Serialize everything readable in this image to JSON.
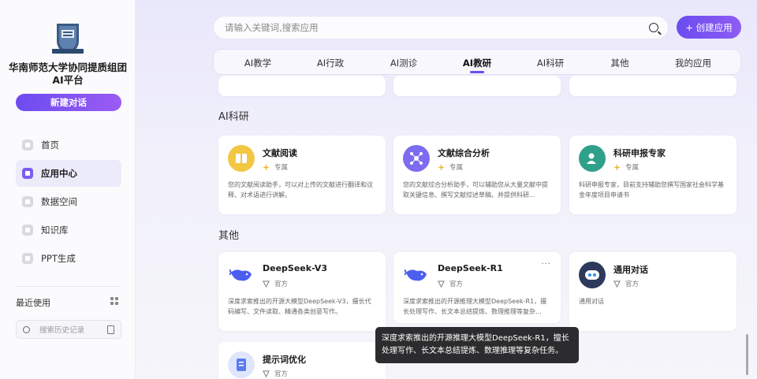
{
  "sidebar": {
    "org_name": "华南师范大学协同提质组团AI平台",
    "new_chat": "新建对话",
    "nav": [
      {
        "label": "首页",
        "icon": "home-icon"
      },
      {
        "label": "应用中心",
        "icon": "apps-icon",
        "active": true
      },
      {
        "label": "数据空间",
        "icon": "data-icon"
      },
      {
        "label": "知识库",
        "icon": "knowledge-icon"
      },
      {
        "label": "PPT生成",
        "icon": "ppt-icon"
      }
    ],
    "recent_label": "最近使用",
    "history_placeholder": "搜索历史记录"
  },
  "header": {
    "search_placeholder": "请输入关键词,搜索应用",
    "create_button": "+ 创建应用",
    "tabs": [
      "AI教学",
      "AI行政",
      "AI测诊",
      "AI教研",
      "AI科研",
      "其他",
      "我的应用"
    ],
    "active_tab": "AI教研"
  },
  "sections": {
    "research": {
      "title": "AI科研",
      "cards": [
        {
          "name": "文献阅读",
          "tag": "专属",
          "desc": "您的文献阅读助手，可以对上传的文献进行翻译和诠释、对术语进行讲解。"
        },
        {
          "name": "文献综合分析",
          "tag": "专属",
          "desc": "您的文献综合分析助手，可以辅助您从大量文献中提取关键信息、撰写文献综述草稿、并提供科研..."
        },
        {
          "name": "科研申报专家",
          "tag": "专属",
          "desc": "科研申报专家，目前支持辅助您撰写国家社会科学基金年度项目申请书"
        }
      ]
    },
    "other": {
      "title": "其他",
      "cards": [
        {
          "name": "DeepSeek-V3",
          "tag": "官方",
          "desc": "深度求索推出的开源大模型DeepSeek-V3，擅长代码编写、文件读取、精通各类创意写作。"
        },
        {
          "name": "DeepSeek-R1",
          "tag": "官方",
          "desc": "深度求索推出的开源推理大模型DeepSeek-R1，擅长处理写作、长文本总结提炼、数理推理等复杂..."
        },
        {
          "name": "通用对话",
          "tag": "官方",
          "desc": "通用对话"
        },
        {
          "name": "提示词优化",
          "tag": "官方",
          "desc": ""
        }
      ]
    }
  },
  "tooltip": "深度求索推出的开源推理大模型DeepSeek-R1，擅长处理写作、长文本总结提炼、数理推理等复杂任务。",
  "colors": {
    "accent": "#6a4cf0",
    "research_1": "#f2c744",
    "research_2": "#7b6cf0",
    "research_3": "#2fa08a"
  }
}
